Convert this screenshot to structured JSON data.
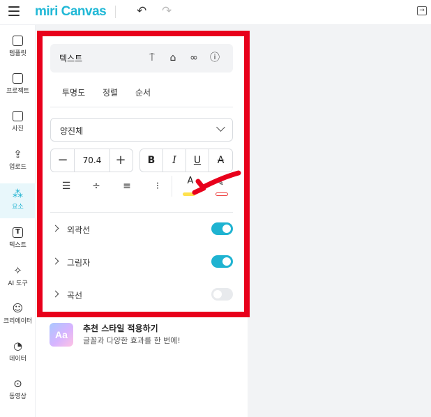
{
  "app": {
    "logo": "miri Canvas"
  },
  "sidebar": {
    "items": [
      {
        "label": "템플릿",
        "icon": "template-icon"
      },
      {
        "label": "프로젝트",
        "icon": "project-icon"
      },
      {
        "label": "사진",
        "icon": "photo-icon"
      },
      {
        "label": "업로드",
        "icon": "upload-icon"
      },
      {
        "label": "요소",
        "icon": "elements-icon",
        "active": true
      },
      {
        "label": "텍스트",
        "icon": "text-icon"
      },
      {
        "label": "AI 도구",
        "icon": "ai-tools-icon"
      },
      {
        "label": "크리에이터",
        "icon": "creator-icon"
      },
      {
        "label": "데이터",
        "icon": "data-icon"
      },
      {
        "label": "동영상",
        "icon": "video-icon"
      }
    ]
  },
  "panel": {
    "toolbar_label": "텍스트",
    "tabs": [
      "투명도",
      "정렬",
      "순서"
    ],
    "font": {
      "value": "양진체"
    },
    "font_size": "70.4",
    "style_buttons": [
      "B",
      "I",
      "U",
      "A"
    ],
    "text_color": "#ffe14d",
    "accordion": [
      {
        "label": "외곽선",
        "on": true
      },
      {
        "label": "그림자",
        "on": true
      },
      {
        "label": "곡선",
        "on": false
      }
    ]
  },
  "recommend": {
    "thumb": "Aa",
    "title": "추천 스타일 적용하기",
    "desc": "글꼴과 다양한 효과를 한 번에!"
  },
  "colors": {
    "accent": "#1fb3d1",
    "highlight_frame": "#e8001b"
  }
}
